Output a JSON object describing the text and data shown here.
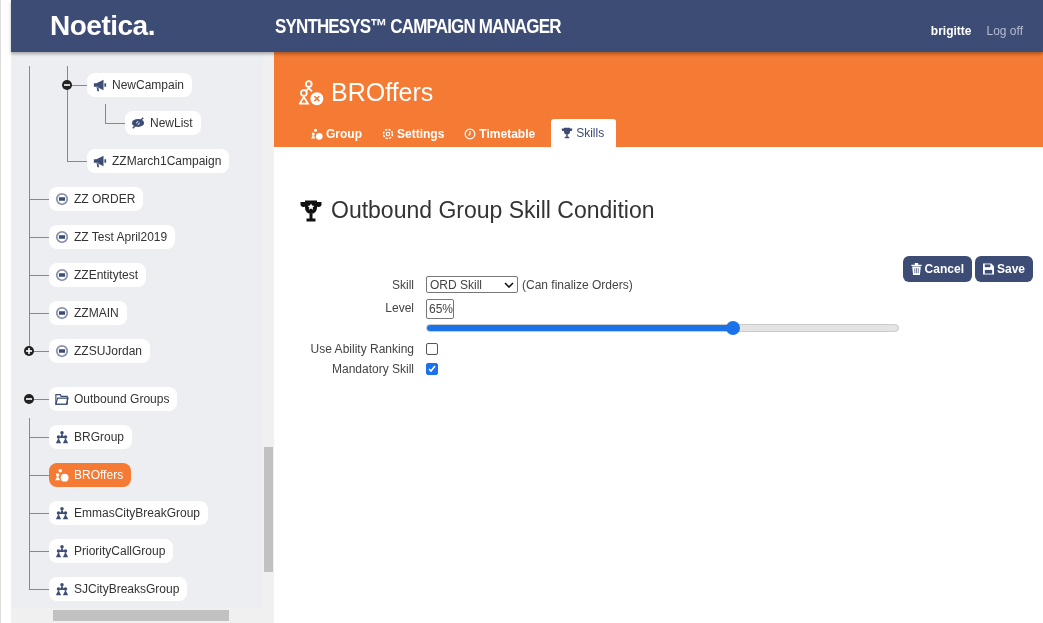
{
  "header": {
    "logo": "Noetica.",
    "title": "SYNTHESYS™ CAMPAIGN MANAGER",
    "user": "brigitte",
    "logoff": "Log off"
  },
  "sidebar": {
    "tree": [
      {
        "children": [
          {
            "children": [
              {
                "label": "NewCampain",
                "kind": "campaign",
                "expanded": true,
                "selected": false,
                "children": [
                  {
                    "label": "NewList",
                    "kind": "list",
                    "selected": false
                  }
                ]
              },
              {
                "label": "ZZMarch1Campaign",
                "kind": "campaign",
                "selected": false
              }
            ]
          },
          {
            "label": "ZZ ORDER",
            "kind": "entity",
            "selected": false
          },
          {
            "label": "ZZ Test April2019",
            "kind": "entity",
            "selected": false
          },
          {
            "label": "ZZEntitytest",
            "kind": "entity",
            "selected": false
          },
          {
            "label": "ZZMAIN",
            "kind": "entity",
            "selected": false
          },
          {
            "label": "ZZSUJordan",
            "kind": "entity",
            "expanded": false,
            "selected": false
          }
        ]
      },
      {
        "label": "Outbound Groups",
        "kind": "folder",
        "expanded": true,
        "selected": false,
        "children": [
          {
            "label": "BRGroup",
            "kind": "group",
            "selected": false
          },
          {
            "label": "BROffers",
            "kind": "group-skill",
            "selected": true
          },
          {
            "label": "EmmasCityBreakGroup",
            "kind": "group",
            "selected": false
          },
          {
            "label": "PriorityCallGroup",
            "kind": "group",
            "selected": false
          },
          {
            "label": "SJCityBreaksGroup",
            "kind": "group",
            "selected": false
          }
        ]
      }
    ]
  },
  "page": {
    "title": "BROffers",
    "tabs": [
      {
        "label": "Group",
        "kind": "group",
        "selected": false
      },
      {
        "label": "Settings",
        "kind": "settings",
        "selected": false
      },
      {
        "label": "Timetable",
        "kind": "timetable",
        "selected": false
      },
      {
        "label": "Skills",
        "kind": "skills",
        "selected": true
      }
    ],
    "heading": "Outbound Group Skill Condition",
    "buttons": [
      {
        "label": "Cancel",
        "kind": "cancel"
      },
      {
        "label": "Save",
        "kind": "save"
      }
    ],
    "form": [
      {
        "kind": "select",
        "label": "Skill",
        "value": "ORD Skill",
        "note": "(Can finalize Orders)"
      },
      {
        "kind": "level",
        "label": "Level",
        "value": "65%",
        "level": 0.65
      },
      {
        "kind": "checkbox",
        "label": "Use Ability Ranking",
        "checked": false
      },
      {
        "kind": "checkbox",
        "label": "Mandatory Skill",
        "checked": true
      }
    ]
  }
}
